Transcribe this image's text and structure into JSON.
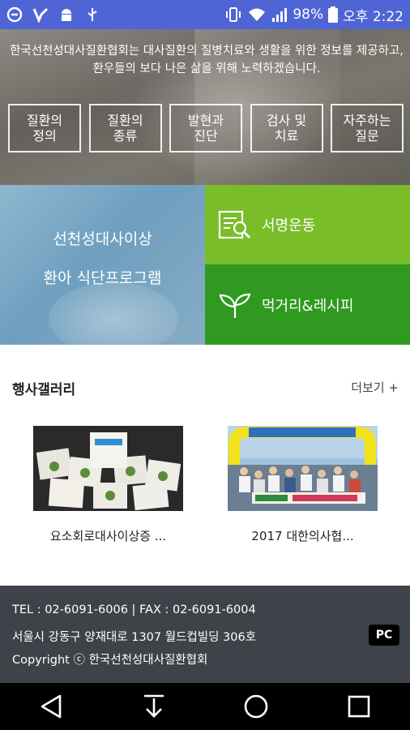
{
  "status_bar": {
    "battery": "98%",
    "time": "오후 2:22",
    "icons": [
      "app-icon",
      "app-icon",
      "android-icon",
      "usb-icon",
      "vibrate-icon",
      "wifi-icon",
      "signal-icon",
      "battery-icon"
    ]
  },
  "hero": {
    "intro": "한국선천성대사질환협회는 대사질환의 질병치료와 생활을 위한 정보를 제공하고, 환우들의 보다 나은 삶을 위해 노력하겠습니다.",
    "buttons": [
      {
        "label": "질환의\n정의"
      },
      {
        "label": "질환의\n종류"
      },
      {
        "label": "발현과\n진단"
      },
      {
        "label": "검사 및\n치료"
      },
      {
        "label": "자주하는\n질문"
      }
    ]
  },
  "promo": {
    "line1": "선천성대사이상",
    "line2": "환아 식단프로그램",
    "tile1": "서명운동",
    "tile2": "먹거리&레시피"
  },
  "gallery": {
    "title": "행사갤러리",
    "more": "더보기 +",
    "items": [
      {
        "caption": "요소회로대사이상증 ..."
      },
      {
        "caption": "2017 대한의사협..."
      }
    ]
  },
  "footer": {
    "phone": "TEL : 02-6091-6006  |  FAX : 02-6091-6004",
    "address": "서울시 강동구 양재대로 1307 월드컵빌딩 306호",
    "copyright": "Copyright ⓒ 한국선천성대사질환협회",
    "pc_label": "PC"
  },
  "colors": {
    "status_bar": "#4f65d6",
    "tile_light_green": "#79be29",
    "tile_dark_green": "#2f9a1f",
    "footer": "#3e434a"
  }
}
